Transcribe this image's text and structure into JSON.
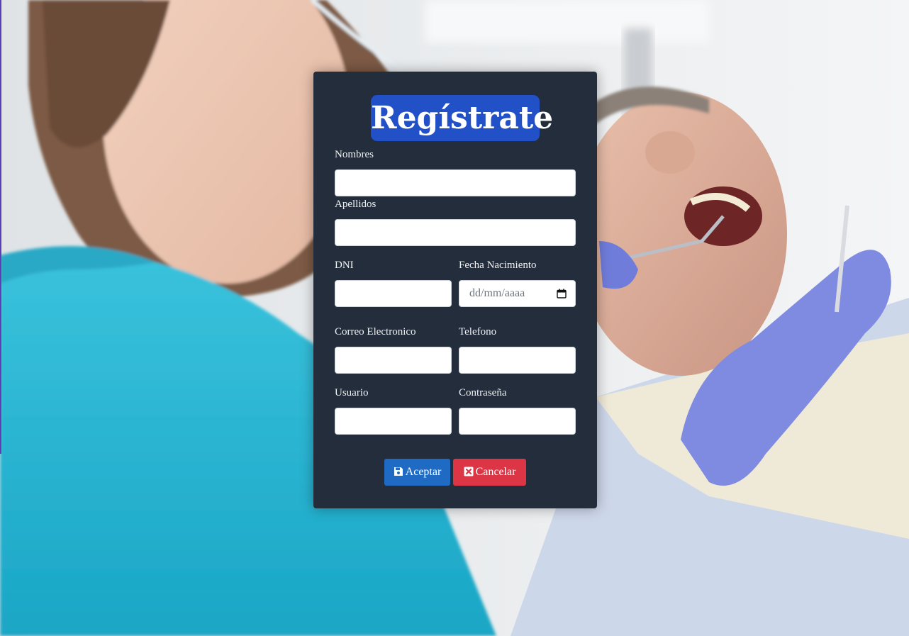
{
  "form": {
    "title": "Regístrate",
    "fields": {
      "nombres": {
        "label": "Nombres",
        "value": ""
      },
      "apellidos": {
        "label": "Apellidos",
        "value": ""
      },
      "dni": {
        "label": "DNI",
        "value": ""
      },
      "fecha": {
        "label": "Fecha Nacimiento",
        "placeholder": "dd/mm/aaaa"
      },
      "correo": {
        "label": "Correo Electronico",
        "value": ""
      },
      "telefono": {
        "label": "Telefono",
        "value": ""
      },
      "usuario": {
        "label": "Usuario",
        "value": ""
      },
      "contrasena": {
        "label": "Contraseña",
        "value": ""
      }
    },
    "buttons": {
      "accept": {
        "label": "Aceptar",
        "icon": "save-icon"
      },
      "cancel": {
        "label": "Cancelar",
        "icon": "close-square-icon"
      }
    }
  },
  "colors": {
    "card_bg": "#232d3b",
    "title_bg": "#2150c7",
    "accept": "#1f6bc4",
    "cancel": "#dc3545"
  }
}
